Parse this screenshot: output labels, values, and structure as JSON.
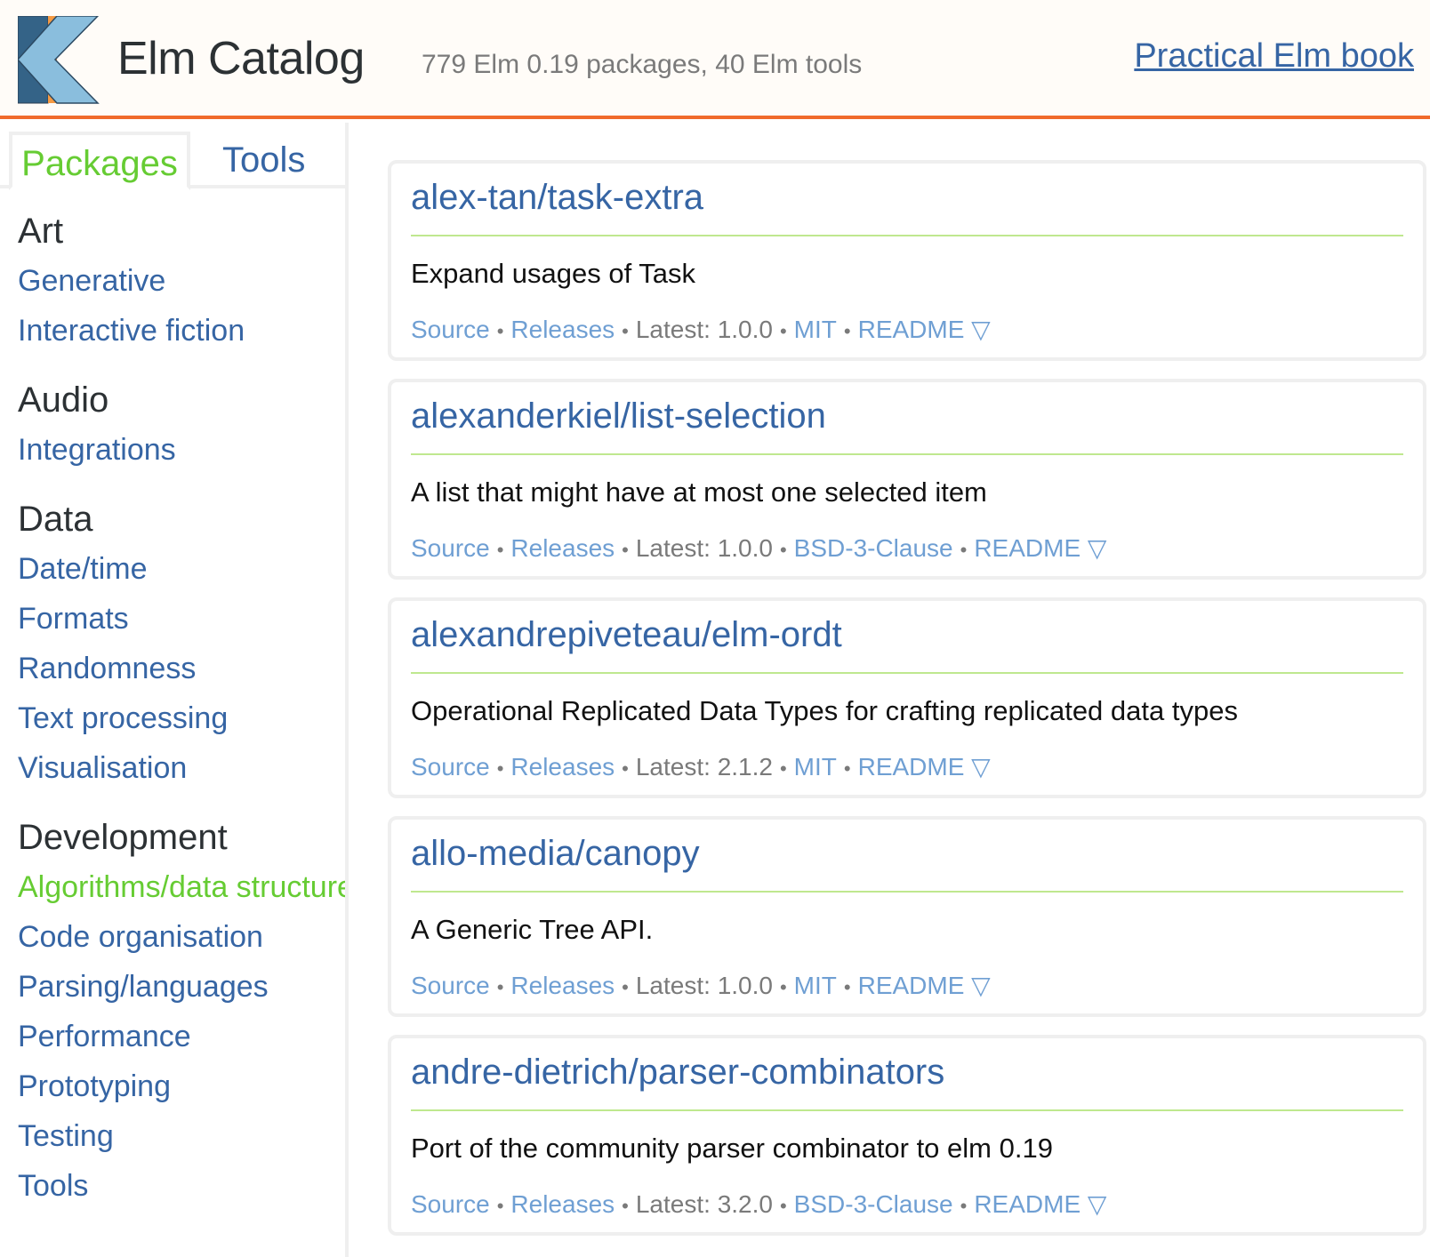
{
  "header": {
    "title": "Elm Catalog",
    "subtitle": "779 Elm 0.19 packages, 40 Elm tools",
    "book_link": "Practical Elm book"
  },
  "colors": {
    "accent_orange": "#f06a2b",
    "link_blue": "#3665a4",
    "active_green": "#66cc33",
    "rule_green": "#bfe88f",
    "meta_link": "#6f9fd3"
  },
  "sidebar": {
    "tabs": [
      {
        "label": "Packages",
        "active": true
      },
      {
        "label": "Tools",
        "active": false
      }
    ],
    "groups": [
      {
        "title": "Art",
        "items": [
          {
            "label": "Generative"
          },
          {
            "label": "Interactive fiction"
          }
        ]
      },
      {
        "title": "Audio",
        "items": [
          {
            "label": "Integrations"
          }
        ]
      },
      {
        "title": "Data",
        "items": [
          {
            "label": "Date/time"
          },
          {
            "label": "Formats"
          },
          {
            "label": "Randomness"
          },
          {
            "label": "Text processing"
          },
          {
            "label": "Visualisation"
          }
        ]
      },
      {
        "title": "Development",
        "items": [
          {
            "label": "Algorithms/data structures",
            "active": true
          },
          {
            "label": "Code organisation"
          },
          {
            "label": "Parsing/languages"
          },
          {
            "label": "Performance"
          },
          {
            "label": "Prototyping"
          },
          {
            "label": "Testing"
          },
          {
            "label": "Tools"
          }
        ]
      }
    ]
  },
  "packages": [
    {
      "name": "alex-tan/task-extra",
      "description": "Expand usages of Task",
      "source": "Source",
      "releases": "Releases",
      "latest": "Latest: 1.0.0",
      "license": "MIT",
      "readme": "README ▽"
    },
    {
      "name": "alexanderkiel/list-selection",
      "description": "A list that might have at most one selected item",
      "source": "Source",
      "releases": "Releases",
      "latest": "Latest: 1.0.0",
      "license": "BSD-3-Clause",
      "readme": "README ▽"
    },
    {
      "name": "alexandrepiveteau/elm-ordt",
      "description": "Operational Replicated Data Types for crafting replicated data types",
      "source": "Source",
      "releases": "Releases",
      "latest": "Latest: 2.1.2",
      "license": "MIT",
      "readme": "README ▽"
    },
    {
      "name": "allo-media/canopy",
      "description": "A Generic Tree API.",
      "source": "Source",
      "releases": "Releases",
      "latest": "Latest: 1.0.0",
      "license": "MIT",
      "readme": "README ▽"
    },
    {
      "name": "andre-dietrich/parser-combinators",
      "description": "Port of the community parser combinator to elm 0.19",
      "source": "Source",
      "releases": "Releases",
      "latest": "Latest: 3.2.0",
      "license": "BSD-3-Clause",
      "readme": "README ▽"
    }
  ],
  "separator": "•"
}
